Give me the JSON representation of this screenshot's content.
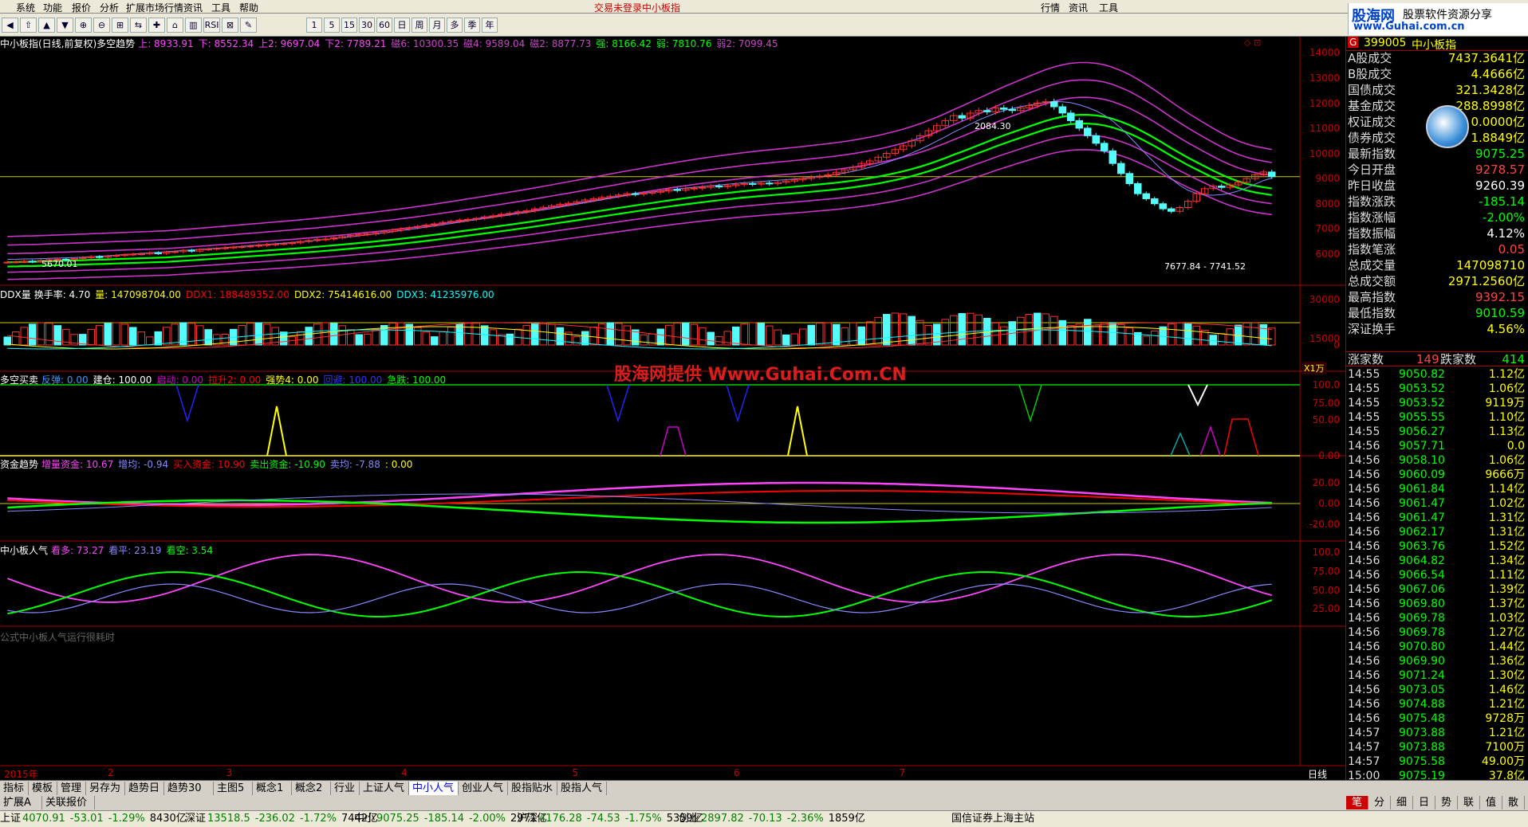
{
  "menu": [
    "系统",
    "功能",
    "报价",
    "分析",
    "扩展市场行情",
    "资讯",
    "工具",
    "帮助"
  ],
  "title_center": "交易未登录",
  "title_index": "中小板指",
  "menu_right": [
    "行情",
    "资讯",
    "工具"
  ],
  "logo_text": "股海网",
  "logo_sub": "股票软件资源分享",
  "logo_url": "www.Guhai.com.cn",
  "toolbar_periods": [
    "1",
    "5",
    "15",
    "30",
    "60",
    "日",
    "周",
    "月",
    "多",
    "季",
    "年"
  ],
  "main_legend": {
    "title": "中小板指(日线,前复权)多空趋势",
    "items": [
      {
        "text": "上: 8933.91",
        "color": "#ff44ff"
      },
      {
        "text": "下: 8552.34",
        "color": "#ff44ff"
      },
      {
        "text": "上2: 9697.04",
        "color": "#ff44ff"
      },
      {
        "text": "下2: 7789.21",
        "color": "#ff44ff"
      },
      {
        "text": "磁6: 10300.35",
        "color": "#cc44cc"
      },
      {
        "text": "磁4: 9589.04",
        "color": "#cc44cc"
      },
      {
        "text": "磁2: 8877.73",
        "color": "#cc44cc"
      },
      {
        "text": "强: 8166.42",
        "color": "#00ff00"
      },
      {
        "text": "弱: 7810.76",
        "color": "#00ff00"
      },
      {
        "text": "弱2: 7099.45",
        "color": "#cc44cc"
      }
    ]
  },
  "main_axis": [
    "14000",
    "13000",
    "12000",
    "11000",
    "10000",
    "9000",
    "8000",
    "7000",
    "6000"
  ],
  "annotations": {
    "high": "2084.30",
    "low": "7677.84 - 7741.52",
    "start": "5670.01"
  },
  "ddx_legend": {
    "title": "DDX量",
    "items": [
      {
        "text": "换手率: 4.70",
        "color": "#ffffff"
      },
      {
        "text": "量: 147098704.00",
        "color": "#ffff00"
      },
      {
        "text": "DDX1: 188489352.00",
        "color": "#ff0000"
      },
      {
        "text": "DDX2: 75414616.00",
        "color": "#ffff00"
      },
      {
        "text": "DDX3: 41235976.00",
        "color": "#00ffff"
      }
    ]
  },
  "ddx_axis": [
    "30000",
    "15000",
    "0"
  ],
  "ddx_unit": "X1万",
  "bs_legend": {
    "title": "多空买卖",
    "items": [
      {
        "text": "反弹: 0.00",
        "color": "#3399ff"
      },
      {
        "text": "建仓: 100.00",
        "color": "#ffffff"
      },
      {
        "text": "启动: 0.00",
        "color": "#cc00cc"
      },
      {
        "text": "拉升2: 0.00",
        "color": "#ff0000"
      },
      {
        "text": "强势4: 0.00",
        "color": "#ffff00"
      },
      {
        "text": "回避: 100.00",
        "color": "#3333ff"
      },
      {
        "text": "急跌: 100.00",
        "color": "#00ff00"
      }
    ]
  },
  "bs_axis": [
    "100.0",
    "75.00",
    "50.00",
    "0.00"
  ],
  "fund_legend": {
    "title": "资金趋势",
    "items": [
      {
        "text": "增量资金: 10.67",
        "color": "#ff44ff"
      },
      {
        "text": "增均: -0.94",
        "color": "#8888ff"
      },
      {
        "text": "买入资金: 10.90",
        "color": "#ff0000"
      },
      {
        "text": "卖出资金: -10.90",
        "color": "#00ff00"
      },
      {
        "text": "卖均: -7.88",
        "color": "#8888ff"
      },
      {
        "text": ": 0.00",
        "color": "#ffff00"
      }
    ]
  },
  "fund_axis": [
    "20.00",
    "0.00",
    "-20.00"
  ],
  "pop_legend": {
    "title": "中小板人气",
    "items": [
      {
        "text": "看多: 73.27",
        "color": "#ff44ff"
      },
      {
        "text": "看平: 23.19",
        "color": "#8888ff"
      },
      {
        "text": "看空: 3.54",
        "color": "#00ff00"
      }
    ]
  },
  "pop_axis": [
    "100.0",
    "75.00",
    "50.00",
    "25.00"
  ],
  "pop_note": "公式中小板人气运行很耗时",
  "date_axis": [
    {
      "label": "2015年",
      "pos": 0.003
    },
    {
      "label": "2",
      "pos": 0.08
    },
    {
      "label": "3",
      "pos": 0.168
    },
    {
      "label": "4",
      "pos": 0.298
    },
    {
      "label": "5",
      "pos": 0.425
    },
    {
      "label": "6",
      "pos": 0.545
    },
    {
      "label": "7",
      "pos": 0.668
    }
  ],
  "date_axis_right": "日线",
  "watermark": "股海网提供 Www.Guhai.Com.CN",
  "side": {
    "code": "399005",
    "name": "中小板指",
    "rows": [
      {
        "label": "A股成交",
        "value": "7437.3641亿",
        "color": "#ffff00"
      },
      {
        "label": "B股成交",
        "value": "4.4666亿",
        "color": "#ffff00"
      },
      {
        "label": "国债成交",
        "value": "321.3428亿",
        "color": "#ffff00"
      },
      {
        "label": "基金成交",
        "value": "288.8998亿",
        "color": "#ffff00"
      },
      {
        "label": "权证成交",
        "value": "0.0000亿",
        "color": "#ffff00"
      },
      {
        "label": "债券成交",
        "value": "1.8849亿",
        "color": "#ffff00"
      },
      {
        "label": "最新指数",
        "value": "9075.25",
        "color": "#00ff00"
      },
      {
        "label": "今日开盘",
        "value": "9278.57",
        "color": "#ff4444"
      },
      {
        "label": "昨日收盘",
        "value": "9260.39",
        "color": "#ffffff"
      },
      {
        "label": "指数涨跌",
        "value": "-185.14",
        "color": "#00ff00"
      },
      {
        "label": "指数涨幅",
        "value": "-2.00%",
        "color": "#00ff00"
      },
      {
        "label": "指数振幅",
        "value": "4.12%",
        "color": "#ffffff"
      },
      {
        "label": "指数笔涨",
        "value": "0.05",
        "color": "#ff4444"
      },
      {
        "label": "总成交量",
        "value": "147098710",
        "color": "#ffff00"
      },
      {
        "label": "总成交额",
        "value": "2971.2560亿",
        "color": "#ffff00"
      },
      {
        "label": "最高指数",
        "value": "9392.15",
        "color": "#ff4444"
      },
      {
        "label": "最低指数",
        "value": "9010.59",
        "color": "#00ff00"
      },
      {
        "label": "深证换手",
        "value": "4.56%",
        "color": "#ffff00"
      }
    ],
    "up_label": "涨家数",
    "up_value": "149",
    "down_label": "跌家数",
    "down_value": "414",
    "ticks": [
      [
        "14:55",
        "9050.82",
        "1.12亿"
      ],
      [
        "14:55",
        "9053.52",
        "1.06亿"
      ],
      [
        "14:55",
        "9053.52",
        "9119万"
      ],
      [
        "14:55",
        "9055.55",
        "1.10亿"
      ],
      [
        "14:55",
        "9056.27",
        "1.13亿"
      ],
      [
        "14:56",
        "9057.71",
        "0.0"
      ],
      [
        "14:56",
        "9058.10",
        "1.06亿"
      ],
      [
        "14:56",
        "9060.09",
        "9666万"
      ],
      [
        "14:56",
        "9061.84",
        "1.14亿"
      ],
      [
        "14:56",
        "9061.47",
        "1.02亿"
      ],
      [
        "14:56",
        "9061.47",
        "1.31亿"
      ],
      [
        "14:56",
        "9062.17",
        "1.31亿"
      ],
      [
        "14:56",
        "9063.76",
        "1.52亿"
      ],
      [
        "14:56",
        "9064.82",
        "1.34亿"
      ],
      [
        "14:56",
        "9066.54",
        "1.11亿"
      ],
      [
        "14:56",
        "9067.06",
        "1.39亿"
      ],
      [
        "14:56",
        "9069.80",
        "1.37亿"
      ],
      [
        "14:56",
        "9069.78",
        "1.03亿"
      ],
      [
        "14:56",
        "9069.78",
        "1.27亿"
      ],
      [
        "14:56",
        "9070.80",
        "1.44亿"
      ],
      [
        "14:56",
        "9069.90",
        "1.36亿"
      ],
      [
        "14:56",
        "9071.24",
        "1.30亿"
      ],
      [
        "14:56",
        "9073.05",
        "1.46亿"
      ],
      [
        "14:56",
        "9074.88",
        "1.21亿"
      ],
      [
        "14:56",
        "9075.48",
        "9728万"
      ],
      [
        "14:57",
        "9073.88",
        "1.21亿"
      ],
      [
        "14:57",
        "9073.88",
        "7100万"
      ],
      [
        "14:57",
        "9075.58",
        "49.00万"
      ],
      [
        "15:00",
        "9075.19",
        "37.8亿"
      ],
      [
        "15:00",
        "9075.25",
        "1.28亿"
      ]
    ]
  },
  "tabs": [
    "指标",
    "模板",
    "管理",
    "另存为",
    "趋势日",
    "趋势30",
    "主图5",
    "概念1",
    "概念2",
    "行业",
    "上证人气",
    "中小人气",
    "创业人气",
    "股指贴水",
    "股指人气"
  ],
  "tabs2": [
    "扩展A",
    "关联报价"
  ],
  "side_tabs": [
    "笔",
    "分",
    "细",
    "日",
    "势",
    "联",
    "值",
    "散"
  ],
  "status": [
    {
      "name": "上证",
      "idx": "4070.91",
      "chg": "-53.01",
      "pct": "-1.29%",
      "amt": "8430亿"
    },
    {
      "name": "深证",
      "idx": "13518.5",
      "chg": "-236.02",
      "pct": "-1.72%",
      "amt": "7442亿"
    },
    {
      "name": "中小",
      "idx": "9075.25",
      "chg": "-185.14",
      "pct": "-2.00%",
      "amt": "2971亿"
    },
    {
      "name": "沪深",
      "idx": "4176.28",
      "chg": "-74.53",
      "pct": "-1.75%",
      "amt": "5359亿"
    },
    {
      "name": "创业",
      "idx": "2897.82",
      "chg": "-70.13",
      "pct": "-2.36%",
      "amt": "1859亿"
    }
  ],
  "status_server": "国信证券上海主站",
  "chart_data": {
    "type": "line",
    "title": "中小板指(日线,前复权)多空趋势",
    "closes": [
      5680,
      5690,
      5720,
      5700,
      5750,
      5780,
      5800,
      5790,
      5830,
      5860,
      5900,
      5880,
      5920,
      5950,
      5980,
      6000,
      6010,
      6050,
      6030,
      6080,
      6100,
      6150,
      6120,
      6180,
      6200,
      6230,
      6250,
      6280,
      6300,
      6320,
      6350,
      6380,
      6400,
      6420,
      6450,
      6500,
      6540,
      6580,
      6600,
      6650,
      6700,
      6740,
      6780,
      6800,
      6850,
      6900,
      6950,
      7000,
      7050,
      7100,
      7150,
      7200,
      7260,
      7300,
      7350,
      7380,
      7420,
      7480,
      7520,
      7580,
      7620,
      7680,
      7720,
      7800,
      7860,
      7920,
      7980,
      8020,
      8080,
      8150,
      8200,
      8250,
      8300,
      8350,
      8400,
      8380,
      8420,
      8460,
      8500,
      8560,
      8540,
      8600,
      8620,
      8650,
      8700,
      8680,
      8720,
      8760,
      8800,
      8780,
      8820,
      8800,
      8850,
      8900,
      8950,
      9000,
      9050,
      9100,
      9150,
      9250,
      9350,
      9450,
      9600,
      9700,
      9850,
      10000,
      10150,
      10300,
      10500,
      10700,
      10900,
      11100,
      11300,
      11500,
      11400,
      11600,
      11700,
      11650,
      11800,
      11750,
      11700,
      11800,
      11900,
      12000,
      12050,
      11850,
      11600,
      11300,
      11000,
      10700,
      10400,
      10100,
      9600,
      9200,
      8800,
      8400,
      8200,
      8000,
      7800,
      7700,
      7850,
      8100,
      8400,
      8600,
      8700,
      8650,
      8750,
      8850,
      9000,
      9150,
      9260,
      9075
    ],
    "ylim": [
      5500,
      14500
    ]
  }
}
